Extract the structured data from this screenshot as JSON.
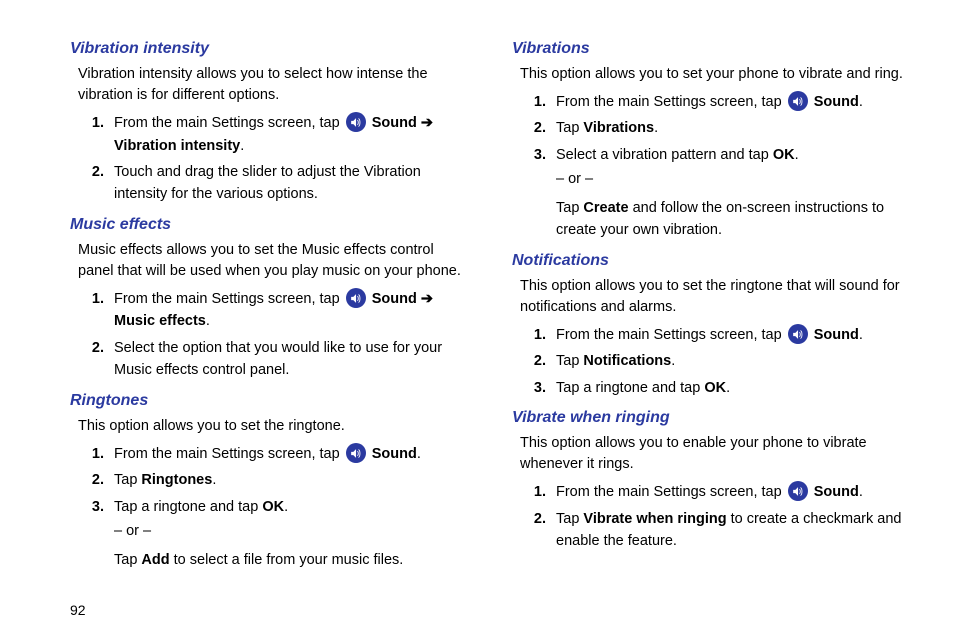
{
  "pageNumber": "92",
  "icons": {
    "sound": "sound-icon"
  },
  "left": {
    "sections": [
      {
        "heading": "Vibration intensity",
        "intro": "Vibration intensity allows you to select how intense the vibration is for different options.",
        "steps": [
          {
            "pre": "From the main Settings screen, tap ",
            "icon": true,
            "post1": " Sound",
            "arrow": " ➔ ",
            "post2": "Vibration intensity",
            "tail": "."
          },
          {
            "text": "Touch and drag the slider to adjust the Vibration intensity for the various options."
          }
        ]
      },
      {
        "heading": "Music effects",
        "intro": "Music effects allows you to set the Music effects control panel that will be used when you play music on your phone.",
        "steps": [
          {
            "pre": "From the main Settings screen, tap ",
            "icon": true,
            "post1": " Sound",
            "arrow": " ➔ ",
            "post2": "Music effects",
            "tail": "."
          },
          {
            "text": "Select the option that you would like to use for your Music effects control panel."
          }
        ]
      },
      {
        "heading": "Ringtones",
        "intro": "This option allows you to set the ringtone.",
        "steps": [
          {
            "pre": "From the main Settings screen, tap ",
            "icon": true,
            "post1": " Sound",
            "tail": "."
          },
          {
            "pre": "Tap ",
            "post1": "Ringtones",
            "tail": "."
          },
          {
            "pre": "Tap a ringtone and tap ",
            "post1": "OK",
            "tail": ".",
            "or": "– or –",
            "afterPre": "Tap ",
            "afterBold": "Add",
            "afterTail": " to select a file from your music files."
          }
        ]
      }
    ]
  },
  "right": {
    "sections": [
      {
        "heading": "Vibrations",
        "intro": "This option allows you to set your phone to vibrate and ring.",
        "steps": [
          {
            "pre": "From the main Settings screen, tap ",
            "icon": true,
            "post1": " Sound",
            "tail": "."
          },
          {
            "pre": "Tap ",
            "post1": "Vibrations",
            "tail": "."
          },
          {
            "pre": "Select a vibration pattern and tap ",
            "post1": "OK",
            "tail": ".",
            "or": "– or –",
            "afterPre": "Tap ",
            "afterBold": "Create",
            "afterTail": " and follow the on-screen instructions to create your own vibration."
          }
        ]
      },
      {
        "heading": "Notifications",
        "intro": "This option allows you to set the ringtone that will sound for notifications and alarms.",
        "steps": [
          {
            "pre": "From the main Settings screen, tap ",
            "icon": true,
            "post1": " Sound",
            "tail": "."
          },
          {
            "pre": "Tap ",
            "post1": "Notifications",
            "tail": "."
          },
          {
            "pre": "Tap a ringtone and tap ",
            "post1": "OK",
            "tail": "."
          }
        ]
      },
      {
        "heading": "Vibrate when ringing",
        "intro": "This option allows you to enable your phone to vibrate whenever it rings.",
        "steps": [
          {
            "pre": "From the main Settings screen, tap ",
            "icon": true,
            "post1": " Sound",
            "tail": "."
          },
          {
            "pre": "Tap ",
            "post1": "Vibrate when ringing",
            "tail": " to create a checkmark and enable the feature."
          }
        ]
      }
    ]
  }
}
